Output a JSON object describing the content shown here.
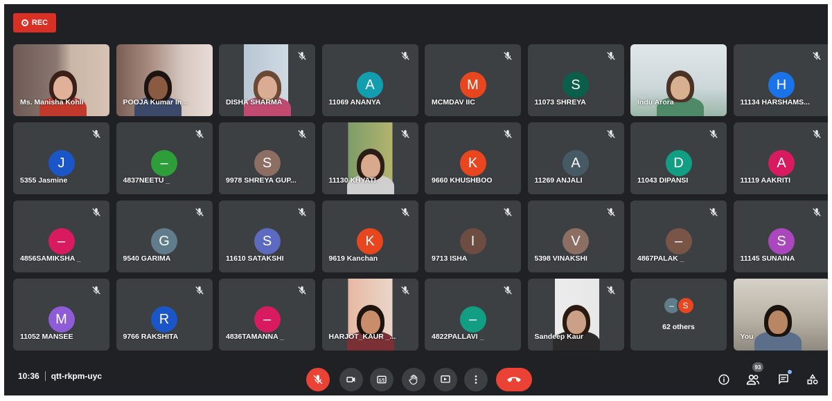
{
  "recording": {
    "label": "REC",
    "color": "#d93025"
  },
  "meeting": {
    "time": "10:36",
    "code": "qtt-rkpm-uyc"
  },
  "participant_count_badge": "93",
  "others_tile": {
    "label": "62 others",
    "avatars": [
      "–",
      "S"
    ]
  },
  "participants": [
    {
      "name": "Ms. Manisha Kohli",
      "type": "video"
    },
    {
      "name": "POOJA Kumar In...",
      "type": "video"
    },
    {
      "name": "DISHA SHARMA",
      "type": "video"
    },
    {
      "name": "11069 ANANYA",
      "initial": "A",
      "color": "#129eaf"
    },
    {
      "name": "MCMDAV IIC",
      "initial": "M",
      "color": "#e8461e"
    },
    {
      "name": "11073 SHREYA",
      "initial": "S",
      "color": "#0b5e4a"
    },
    {
      "name": "Indu Arora",
      "type": "video"
    },
    {
      "name": "11134 HARSHAMS...",
      "initial": "H",
      "color": "#1a73e8"
    },
    {
      "name": "5355 Jasmine",
      "initial": "J",
      "color": "#1a56c8"
    },
    {
      "name": "4837NEETU _",
      "initial": "–",
      "color": "#2e9e3a"
    },
    {
      "name": "9978 SHREYA GUP...",
      "initial": "S",
      "color": "#8d6e63"
    },
    {
      "name": "11130 KHYATI",
      "type": "video"
    },
    {
      "name": "9660 KHUSHBOO",
      "initial": "K",
      "color": "#e8461e"
    },
    {
      "name": "11269 ANJALI",
      "initial": "A",
      "color": "#455a64"
    },
    {
      "name": "11043 DIPANSI",
      "initial": "D",
      "color": "#129e82"
    },
    {
      "name": "11119 AAKRITI",
      "initial": "A",
      "color": "#d81b60"
    },
    {
      "name": "4856SAMIKSHA _",
      "initial": "–",
      "color": "#d81b60"
    },
    {
      "name": "9540 GARIMA",
      "initial": "G",
      "color": "#607d8b"
    },
    {
      "name": "11610 SATAKSHI",
      "initial": "S",
      "color": "#5c6bc0"
    },
    {
      "name": "9619 Kanchan",
      "initial": "K",
      "color": "#e8461e"
    },
    {
      "name": "9713 ISHA",
      "initial": "I",
      "color": "#6d4c41"
    },
    {
      "name": "5398 VINAKSHI",
      "initial": "V",
      "color": "#8d6e63"
    },
    {
      "name": "4867PALAK _",
      "initial": "–",
      "color": "#795548"
    },
    {
      "name": "11145 SUNAINA",
      "initial": "S",
      "color": "#ab47bc"
    },
    {
      "name": "11052 MANSEE",
      "initial": "M",
      "color": "#8e5cd6"
    },
    {
      "name": "9766 RAKSHITA",
      "initial": "R",
      "color": "#1a56c8"
    },
    {
      "name": "4836TAMANNA _",
      "initial": "–",
      "color": "#d81b60"
    },
    {
      "name": "HARJOT_KAUR _...",
      "type": "video"
    },
    {
      "name": "4822PALLAVI _",
      "initial": "–",
      "color": "#129e82"
    },
    {
      "name": "Sandeep Kaur",
      "type": "video"
    },
    {
      "name": "",
      "type": "others"
    },
    {
      "name": "You",
      "type": "video"
    }
  ],
  "controls": [
    {
      "name": "mic-off-button",
      "icon": "mic-off-icon"
    },
    {
      "name": "camera-button",
      "icon": "camera-icon"
    },
    {
      "name": "captions-button",
      "icon": "captions-icon"
    },
    {
      "name": "raise-hand-button",
      "icon": "hand-icon"
    },
    {
      "name": "present-button",
      "icon": "present-icon"
    },
    {
      "name": "more-options-button",
      "icon": "more-vert-icon"
    },
    {
      "name": "leave-call-button",
      "icon": "call-end-icon"
    }
  ],
  "right_controls": [
    {
      "name": "meeting-details-button",
      "icon": "info-icon"
    },
    {
      "name": "people-button",
      "icon": "people-icon"
    },
    {
      "name": "chat-button",
      "icon": "chat-icon"
    },
    {
      "name": "activities-button",
      "icon": "shapes-icon"
    }
  ]
}
